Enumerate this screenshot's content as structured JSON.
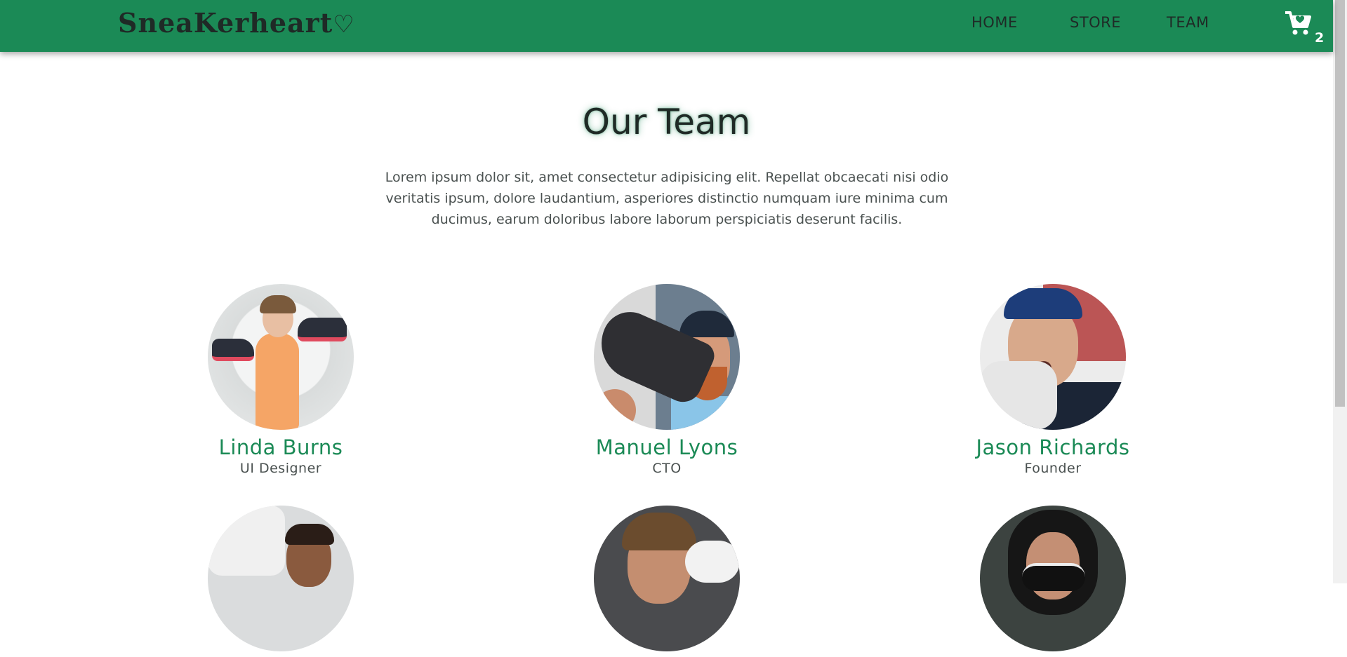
{
  "header": {
    "logo_text": "SneaKerheart",
    "logo_heart": "♡",
    "nav": [
      {
        "label": "HOME"
      },
      {
        "label": "STORE"
      },
      {
        "label": "TEAM"
      }
    ],
    "cart_icon": "shopping-cart-icon",
    "cart_count": "2"
  },
  "colors": {
    "brand": "#1b8a56",
    "dark": "#1f2a26",
    "text": "#4a5150"
  },
  "main": {
    "title": "Our Team",
    "intro": "Lorem ipsum dolor sit, amet consectetur adipisicing elit. Repellat obcaecati nisi odio veritatis ipsum, dolore laudantium, asperiores distinctio numquam iure minima cum ducimus, earum doloribus labore laborum perspiciatis deserunt facilis.",
    "members": [
      {
        "name": "Linda Burns",
        "role": "UI Designer"
      },
      {
        "name": "Manuel Lyons",
        "role": "CTO"
      },
      {
        "name": "Jason Richards",
        "role": "Founder"
      },
      {
        "name": "",
        "role": ""
      },
      {
        "name": "",
        "role": ""
      },
      {
        "name": "",
        "role": ""
      }
    ]
  }
}
